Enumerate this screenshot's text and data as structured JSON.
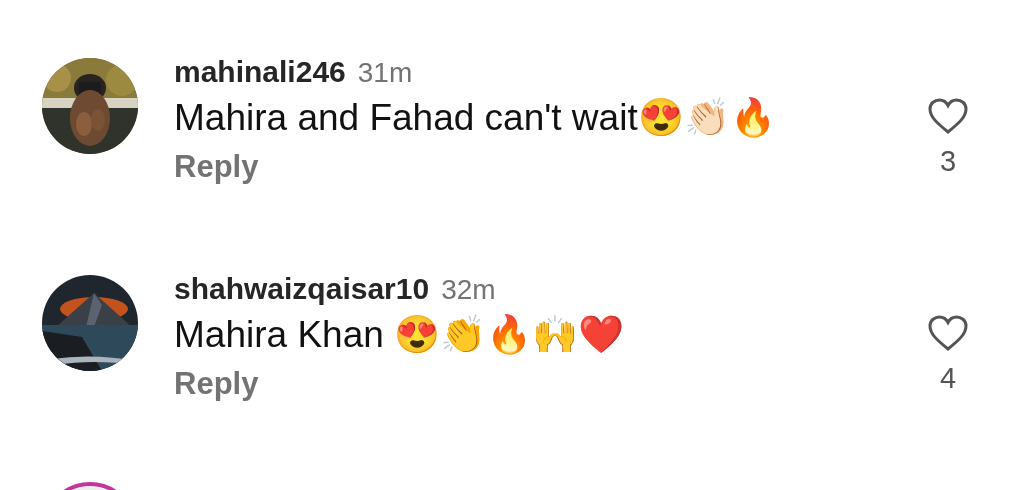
{
  "comments": [
    {
      "username": "mahinali246",
      "time": "31m",
      "text": "Mahira and Fahad can't wait😍👏🏻🔥",
      "reply": "Reply",
      "likes": "3",
      "liked": false,
      "avatar": {
        "kind": "portrait"
      }
    },
    {
      "username": "shahwaizqaisar10",
      "time": "32m",
      "text": "Mahira Khan 😍👏🔥🙌❤️",
      "reply": "Reply",
      "likes": "4",
      "liked": false,
      "avatar": {
        "kind": "landscape"
      }
    }
  ],
  "next_avatar": {
    "kind": "ring"
  }
}
